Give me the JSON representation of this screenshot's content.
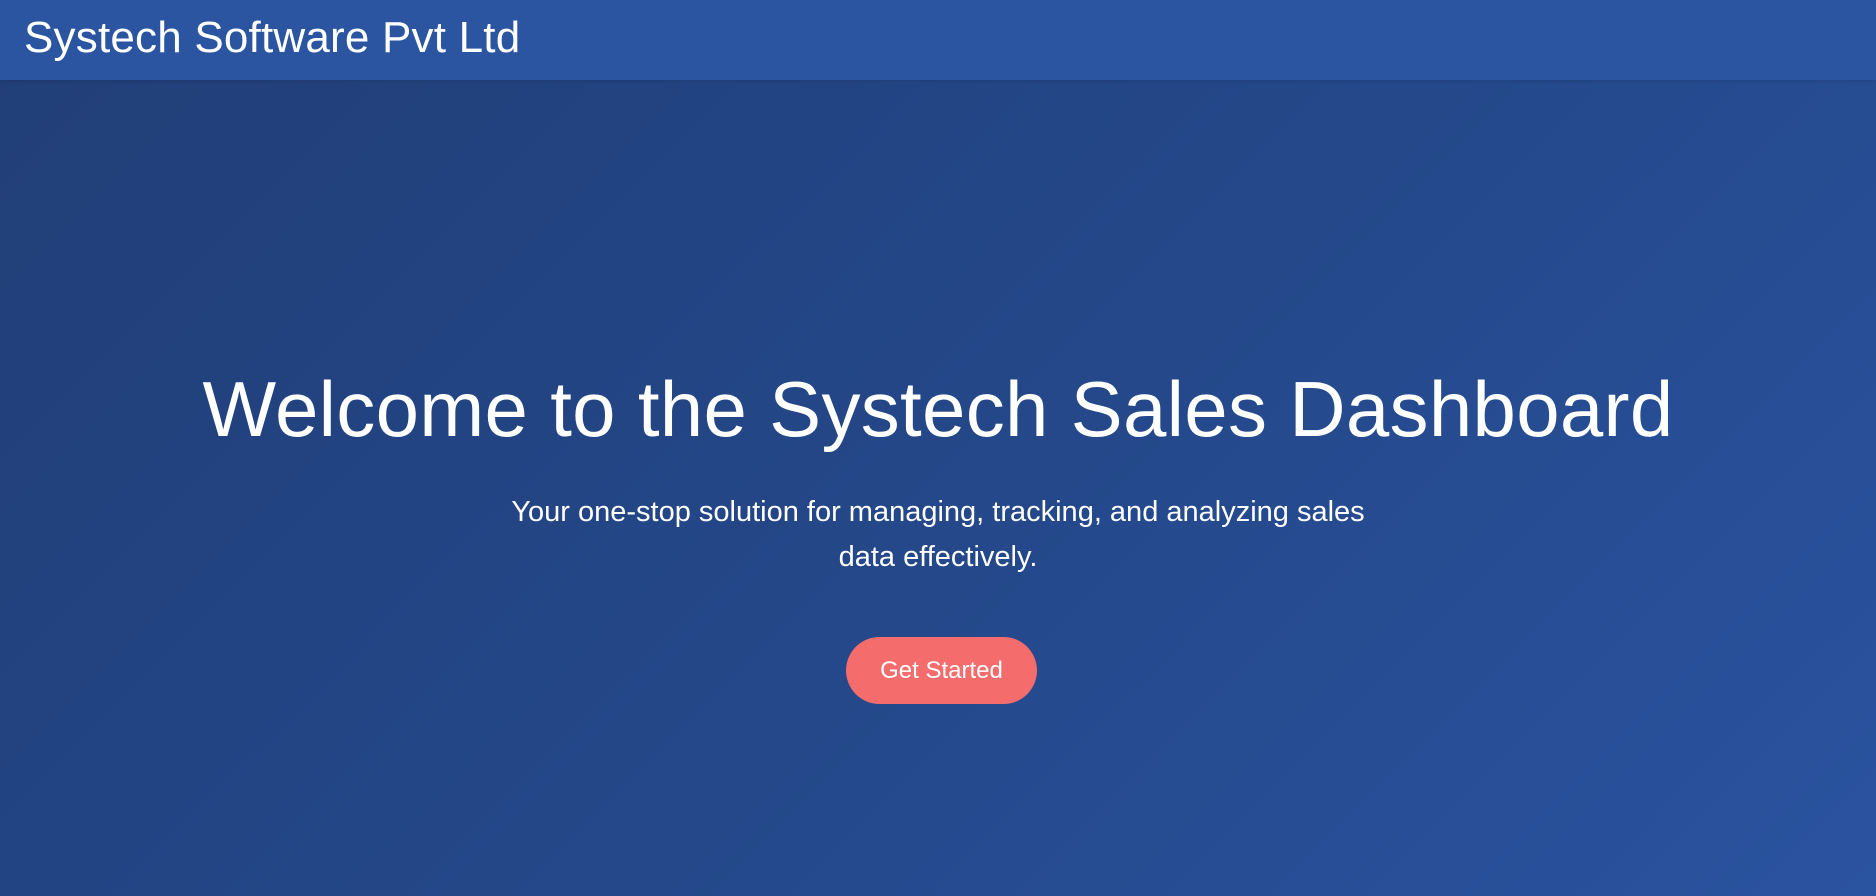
{
  "header": {
    "brand_name": "Systech Software Pvt Ltd"
  },
  "hero": {
    "title": "Welcome to the Systech Sales Dashboard",
    "subtitle": "Your one-stop solution for managing, tracking, and analyzing sales data effectively.",
    "cta_label": "Get Started"
  },
  "colors": {
    "background": "#24488a",
    "header": "#2b55a0",
    "cta": "#f56c6c",
    "text": "#ffffff"
  }
}
